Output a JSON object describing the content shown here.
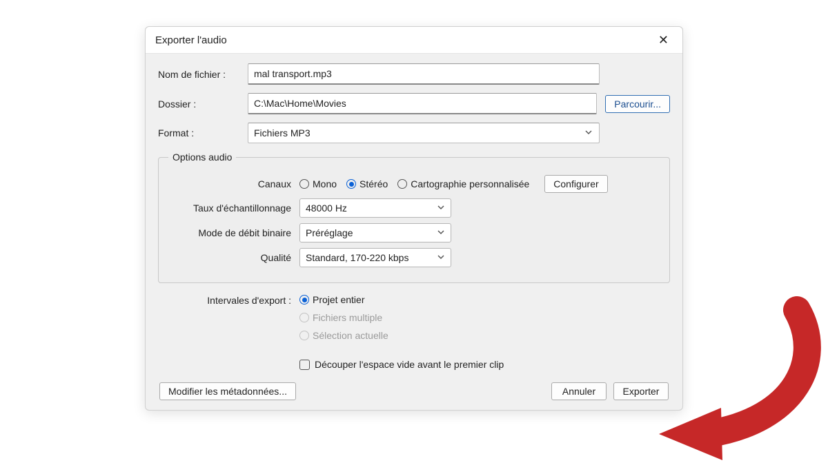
{
  "dialog": {
    "title": "Exporter l'audio",
    "filename_label": "Nom de fichier :",
    "filename_value": "mal transport.mp3",
    "folder_label": "Dossier :",
    "folder_value": "C:\\Mac\\Home\\Movies",
    "browse_button": "Parcourir...",
    "format_label": "Format :",
    "format_value": "Fichiers MP3"
  },
  "audio": {
    "legend": "Options audio",
    "channels_label": "Canaux",
    "channel_mono": "Mono",
    "channel_stereo": "Stéréo",
    "channel_custom": "Cartographie personnalisée",
    "configure_button": "Configurer",
    "sample_rate_label": "Taux d'échantillonnage",
    "sample_rate_value": "48000 Hz",
    "bitrate_mode_label": "Mode de débit binaire",
    "bitrate_mode_value": "Préréglage",
    "quality_label": "Qualité",
    "quality_value": "Standard, 170-220 kbps"
  },
  "export_range": {
    "label": "Intervales d'export :",
    "opt_full": "Projet entier",
    "opt_multi": "Fichiers multiple",
    "opt_selection": "Sélection actuelle",
    "trim_label": "Découper l'espace vide avant le premier clip"
  },
  "footer": {
    "metadata_button": "Modifier les métadonnées...",
    "cancel_button": "Annuler",
    "export_button": "Exporter"
  },
  "annotation_color": "#c62828"
}
